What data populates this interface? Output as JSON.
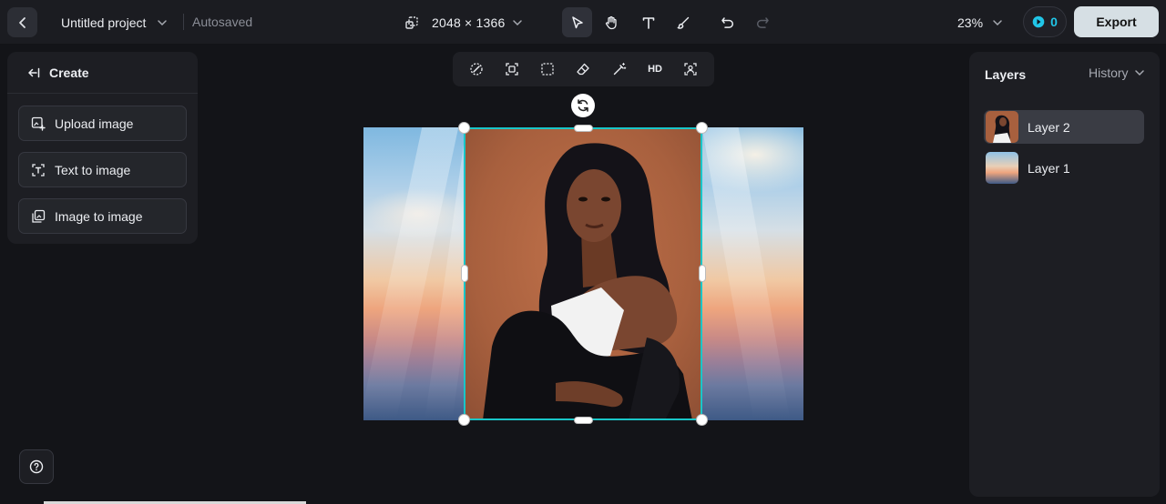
{
  "header": {
    "project_title": "Untitled project",
    "save_status": "Autosaved",
    "canvas_size": "2048 × 1366",
    "zoom": "23%",
    "credits": "0",
    "export_label": "Export"
  },
  "create_panel": {
    "title": "Create",
    "items": [
      {
        "label": "Upload image",
        "icon": "upload-image-icon"
      },
      {
        "label": "Text to image",
        "icon": "text-to-image-icon"
      },
      {
        "label": "Image to image",
        "icon": "image-to-image-icon"
      }
    ]
  },
  "image_toolbar": {
    "hd_label": "HD"
  },
  "layers_panel": {
    "title": "Layers",
    "history_label": "History",
    "layers": [
      {
        "name": "Layer 2",
        "selected": true
      },
      {
        "name": "Layer 1",
        "selected": false
      }
    ]
  },
  "colors": {
    "accent": "#19c6c8",
    "credits": "#21c6e8",
    "export_bg": "#d6dfe4",
    "background": "#131418"
  }
}
